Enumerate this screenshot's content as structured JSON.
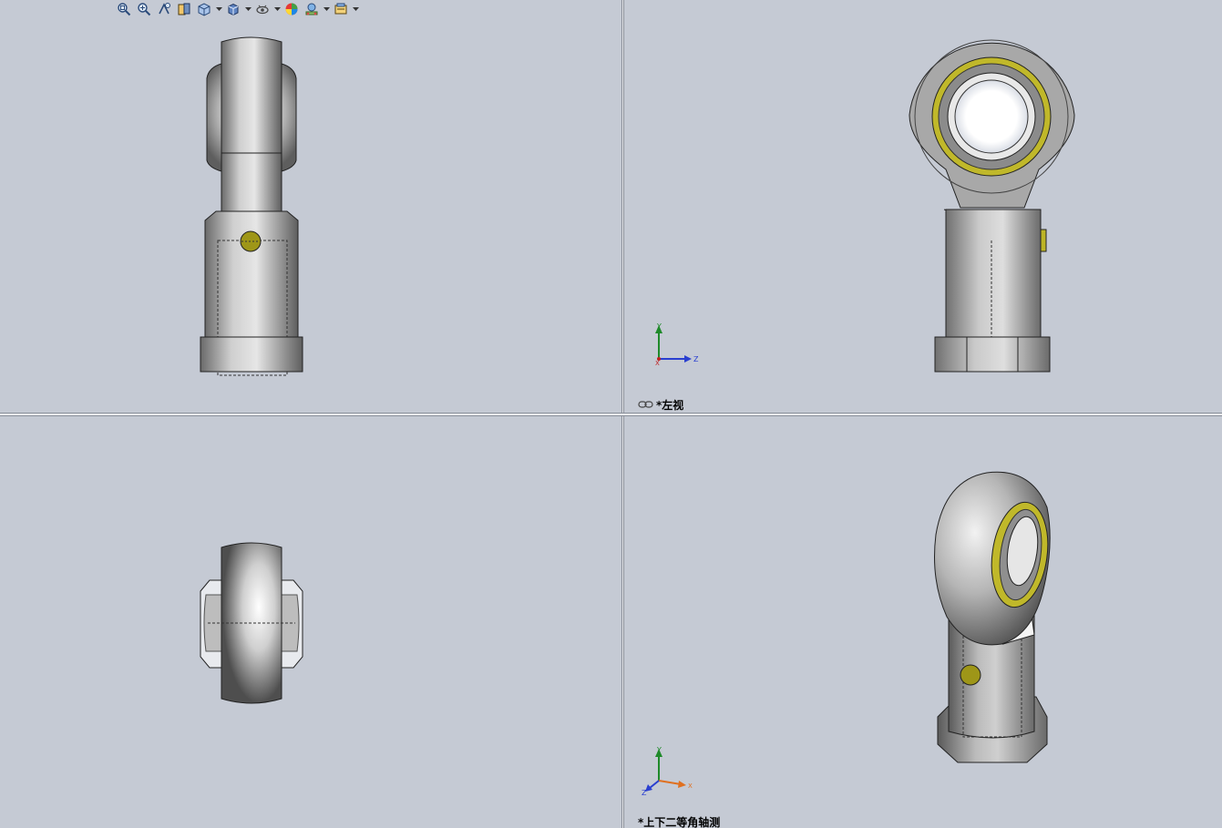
{
  "toolbar": {
    "icons": [
      "zoom-to-fit-icon",
      "zoom-to-area-icon",
      "previous-view-icon",
      "section-view-icon",
      "view-orientation-icon",
      "display-style-icon",
      "hide-show-items-icon",
      "edit-appearance-icon",
      "apply-scene-icon",
      "view-settings-icon"
    ]
  },
  "views": {
    "top_right": {
      "label": "*左视",
      "triad": {
        "y": "Y",
        "z": "Z",
        "x": "X"
      }
    },
    "bottom_right": {
      "label": "*上下二等角轴测",
      "triad": {
        "y": "Y",
        "z": "Z",
        "x": "X"
      }
    }
  },
  "colors": {
    "background": "#c5cad4",
    "metal_light": "#e4e4e4",
    "metal_dark": "#6e6e6e",
    "bronze": "#bdb526",
    "bronze_dark": "#5a5510"
  }
}
